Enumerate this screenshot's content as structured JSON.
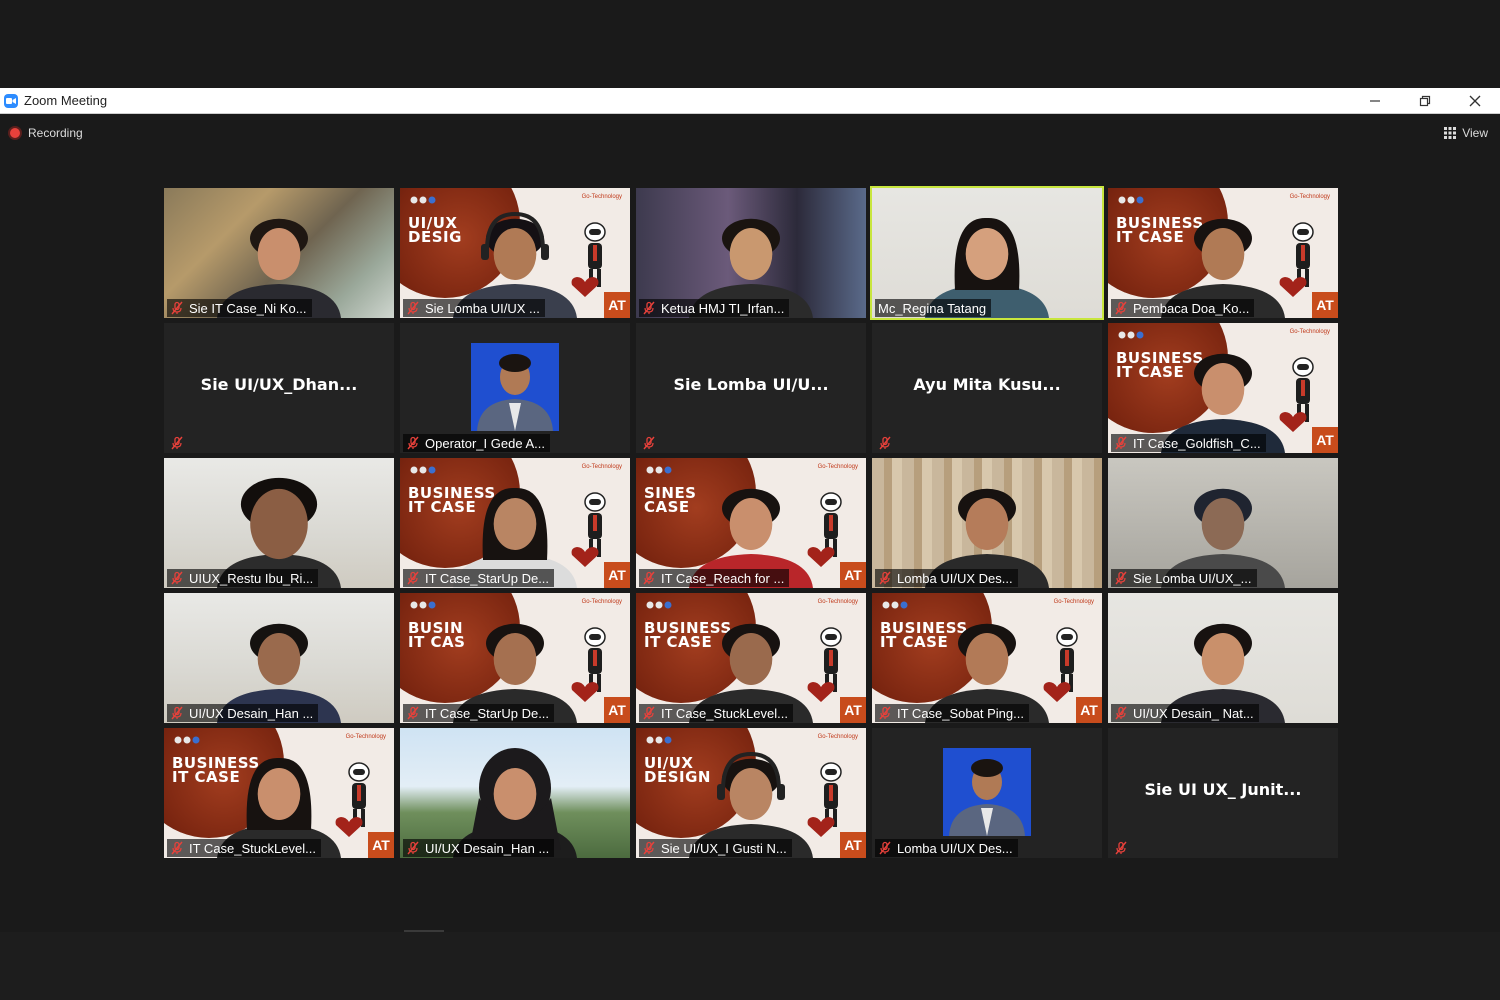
{
  "window": {
    "title": "Zoom Meeting"
  },
  "colors": {
    "recording": "#e8413b",
    "active_speaker": "#c8e63d",
    "zoom_brand": "#2d8cff",
    "muted_mic": "#e8413b"
  },
  "toolbar": {
    "recording_label": "Recording",
    "view_label": "View"
  },
  "participants": [
    {
      "name": "Sie IT Case_Ni Ko...",
      "video": true,
      "muted": true
    },
    {
      "name": "Sie Lomba UI/UX ...",
      "video": true,
      "muted": true,
      "poster_text": "UI/UX DESIG"
    },
    {
      "name": "Ketua HMJ TI_Irfan...",
      "video": true,
      "muted": true
    },
    {
      "name": "Mc_Regina Tatang",
      "video": true,
      "muted": false,
      "active_speaker": true
    },
    {
      "name": "Pembaca Doa_Ko...",
      "video": true,
      "muted": true,
      "poster_text": "BUSINESS IT CASE"
    },
    {
      "name": "Sie  UI/UX_Dhan...",
      "video": false,
      "muted": true
    },
    {
      "name": "Operator_I Gede A...",
      "video": false,
      "muted": true,
      "has_profile_photo": true
    },
    {
      "name": "Sie Lomba UI/U...",
      "video": false,
      "muted": true
    },
    {
      "name": "Ayu Mita Kusu...",
      "video": false,
      "muted": true
    },
    {
      "name": "IT Case_Goldfish_C...",
      "video": true,
      "muted": true,
      "poster_text": "BUSINESS IT CASE"
    },
    {
      "name": "UIUX_Restu Ibu_Ri...",
      "video": true,
      "muted": true
    },
    {
      "name": "IT Case_StarUp De...",
      "video": true,
      "muted": true,
      "poster_text": "BUSINESS IT CASE"
    },
    {
      "name": "IT Case_Reach for ...",
      "video": true,
      "muted": true,
      "poster_text": "SINES CASE"
    },
    {
      "name": "Lomba UI/UX Des...",
      "video": true,
      "muted": true
    },
    {
      "name": "Sie Lomba UI/UX_...",
      "video": true,
      "muted": true
    },
    {
      "name": "UI/UX Desain_Han ...",
      "video": true,
      "muted": true
    },
    {
      "name": "IT Case_StarUp De...",
      "video": true,
      "muted": true,
      "poster_text": "BUSIN IT CAS"
    },
    {
      "name": "IT Case_StuckLevel...",
      "video": true,
      "muted": true,
      "poster_text": "BUSINESS IT CASE"
    },
    {
      "name": "IT Case_Sobat Ping...",
      "video": true,
      "muted": true,
      "poster_text": "BUSINESS IT CASE"
    },
    {
      "name": "UI/UX Desain_ Nat...",
      "video": true,
      "muted": true
    },
    {
      "name": "IT Case_StuckLevel...",
      "video": true,
      "muted": true,
      "poster_text": "BUSINESS IT CASE"
    },
    {
      "name": "UI/UX Desain_Han ...",
      "video": true,
      "muted": true
    },
    {
      "name": "Sie UI/UX_I Gusti N...",
      "video": true,
      "muted": true,
      "poster_text": "UI/UX DESIGN"
    },
    {
      "name": "Lomba UI/UX Des...",
      "video": true,
      "muted": true,
      "has_profile_photo": true
    },
    {
      "name": "Sie UI UX_ Junit...",
      "video": false,
      "muted": true
    }
  ],
  "poster": {
    "corner_mark": "AT",
    "tag": "Go-Technology"
  }
}
